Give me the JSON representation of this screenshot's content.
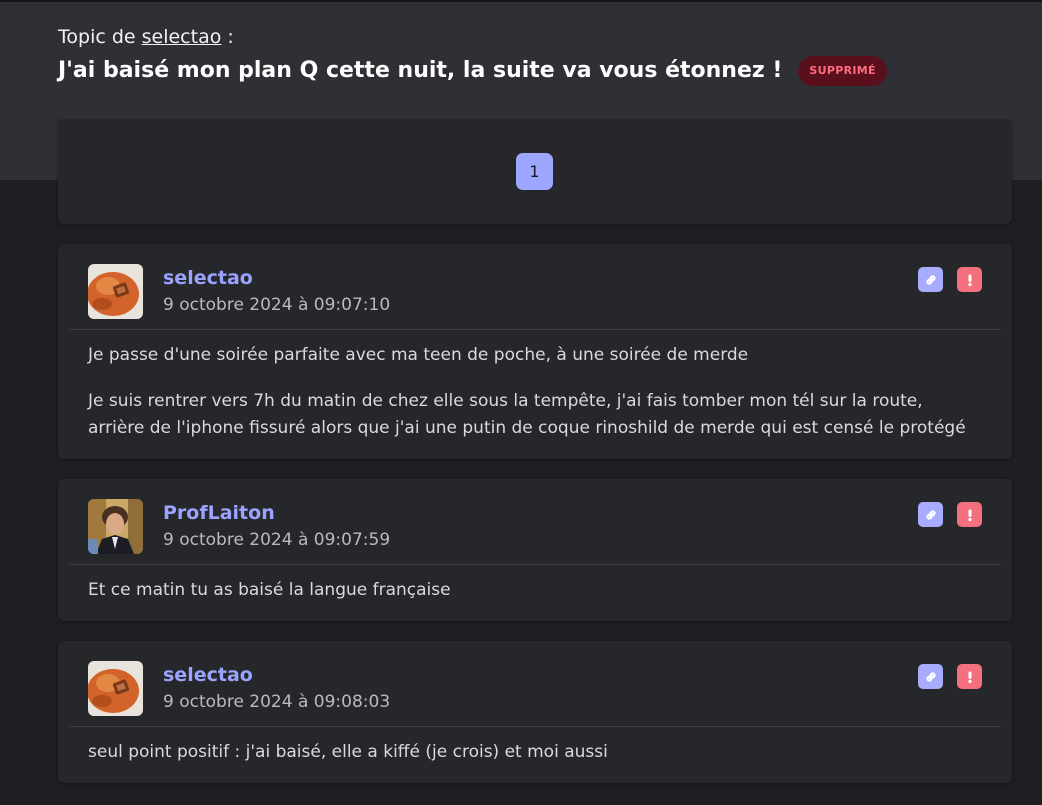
{
  "topic": {
    "by_prefix": "Topic de",
    "by_author": "selectao",
    "by_suffix": ":",
    "title": "J'ai baisé mon plan Q cette nuit, la suite va vous étonnez !",
    "status_badge": "SUPPRIMÉ",
    "status_color": "#ff6b7f"
  },
  "pagination": {
    "current_page": "1"
  },
  "colors": {
    "accent": "#9aa4ff",
    "report": "#f4707f",
    "background": "#1e1f22",
    "card": "#26272b"
  },
  "posts": [
    {
      "author": "selectao",
      "date": "9 octobre 2024 à 09:07:10",
      "avatar_icon": "avatar-orange-image",
      "link_icon": "link-icon",
      "report_icon": "exclamation-icon",
      "paragraphs": [
        "Je passe d'une soirée parfaite avec ma teen de poche, à une soirée de merde",
        "Je suis rentrer vers 7h du matin de chez elle sous la tempête, j'ai fais tomber mon tél sur la route, arrière de l'iphone fissuré alors que j'ai une putin de coque rinoshild de merde qui est censé le protégé"
      ]
    },
    {
      "author": "ProfLaiton",
      "date": "9 octobre 2024 à 09:07:59",
      "avatar_icon": "avatar-man-photo",
      "link_icon": "link-icon",
      "report_icon": "exclamation-icon",
      "paragraphs": [
        "Et ce matin tu as baisé la langue française"
      ]
    },
    {
      "author": "selectao",
      "date": "9 octobre 2024 à 09:08:03",
      "avatar_icon": "avatar-orange-image",
      "link_icon": "link-icon",
      "report_icon": "exclamation-icon",
      "paragraphs": [
        "seul point positif : j'ai baisé, elle a kiffé (je crois) et moi aussi"
      ]
    }
  ]
}
